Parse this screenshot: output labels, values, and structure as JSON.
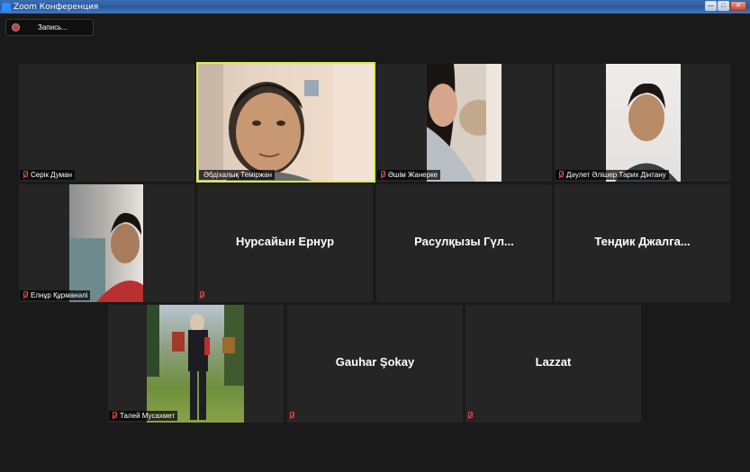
{
  "window": {
    "title": "Zoom Конференция"
  },
  "recording": {
    "label": "Запись..."
  },
  "participants": [
    {
      "name": "Серік Думан",
      "video": false,
      "muted": true
    },
    {
      "name": "Әбдіхалық Теміржан",
      "video": true,
      "muted": false,
      "active_speaker": true
    },
    {
      "name": "Әшім Жанеркe",
      "video": true,
      "muted": true
    },
    {
      "name": "Дәулет Әлішер Тарих Дінтану",
      "video": true,
      "muted": true
    },
    {
      "name": "Елнұр Құрманәлі",
      "video": true,
      "muted": true
    },
    {
      "name": "Нурсайын Ернур",
      "display_name": "Нурсайын Ернур",
      "video": false,
      "muted": true
    },
    {
      "name": "Расулқызы Гүл...",
      "display_name": "Расулқызы Гүл...",
      "video": false,
      "muted": false
    },
    {
      "name": "Тендик Джалга...",
      "display_name": "Тендик Джалга...",
      "video": false,
      "muted": false
    },
    {
      "name": "Талей Мусахмет",
      "video": true,
      "muted": true
    },
    {
      "name": "Gauhar Şokay",
      "display_name": "Gauhar Şokay",
      "video": false,
      "muted": true
    },
    {
      "name": "Lazzat",
      "display_name": "Lazzat",
      "video": false,
      "muted": true
    }
  ],
  "colors": {
    "active_speaker_border": "#d8f04a",
    "mute_icon": "#e84545",
    "tile_bg": "#252525"
  }
}
